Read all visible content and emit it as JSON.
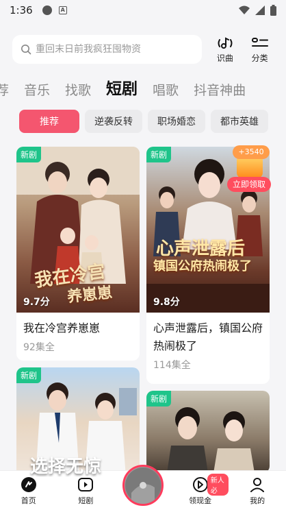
{
  "status_bar": {
    "time": "1:36",
    "notification_icon": "A"
  },
  "search": {
    "placeholder": "重回末日前我疯狂囤物资"
  },
  "top_actions": [
    {
      "icon": "music-recognize-icon",
      "label": "识曲"
    },
    {
      "icon": "category-icon",
      "label": "分类"
    }
  ],
  "tabs": [
    {
      "label": "荐",
      "active": false
    },
    {
      "label": "音乐",
      "active": false
    },
    {
      "label": "找歌",
      "active": false
    },
    {
      "label": "短剧",
      "active": true
    },
    {
      "label": "唱歌",
      "active": false
    },
    {
      "label": "抖音神曲",
      "active": false
    }
  ],
  "chips": [
    {
      "label": "推荐",
      "active": true
    },
    {
      "label": "逆袭反转",
      "active": false
    },
    {
      "label": "职场婚恋",
      "active": false
    },
    {
      "label": "都市英雄",
      "active": false
    }
  ],
  "cards": [
    {
      "badge": "新剧",
      "rating": "9.7分",
      "title": "我在冷宫养崽崽",
      "episodes": "92集全",
      "poster_text_1": "我在冷宫",
      "poster_text_2": "养崽崽"
    },
    {
      "badge": "新剧",
      "rating": "9.8分",
      "title": "心声泄露后，镇国公府热闹极了",
      "episodes": "114集全",
      "poster_text_1": "心声泄露后",
      "poster_text_2": "镇国公府热闹极了"
    },
    {
      "badge": "新剧",
      "poster_text_1": "选择无惊"
    },
    {
      "badge": "新剧"
    }
  ],
  "reward": {
    "amount": "+3540",
    "claim_label": "立即领取"
  },
  "bottom_nav": [
    {
      "icon": "home-icon",
      "label": "首页",
      "active": true
    },
    {
      "icon": "short-drama-icon",
      "label": "短剧",
      "active": false
    },
    {
      "icon": "earn-cash-icon",
      "label": "领现金",
      "badge": "新人必",
      "active": false
    },
    {
      "icon": "profile-icon",
      "label": "我的",
      "active": false
    }
  ],
  "colors": {
    "accent": "#f4566f",
    "badge_green": "#1fc48a",
    "reward_red": "#ff4d5e"
  }
}
